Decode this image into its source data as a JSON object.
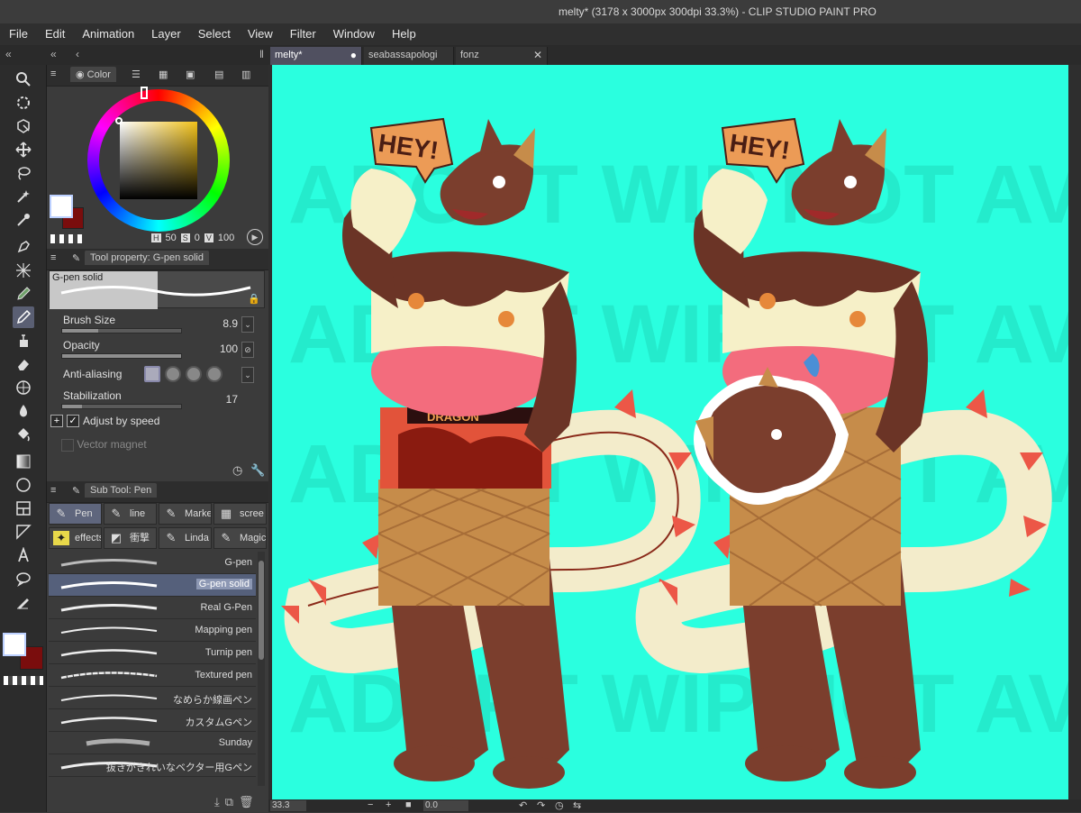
{
  "window": {
    "title": "melty* (3178 x 3000px 300dpi 33.3%)  - CLIP STUDIO PAINT PRO"
  },
  "menu": [
    "File",
    "Edit",
    "Animation",
    "Layer",
    "Select",
    "View",
    "Filter",
    "Window",
    "Help"
  ],
  "color_panel": {
    "tab_label": "Color",
    "main_color": "#ffffff",
    "sub_color": "#7a0d0d",
    "hue_color": "#f2c21a",
    "h_label": "H",
    "h_value": "50",
    "s_label": "S",
    "s_value": "0",
    "v_label": "V",
    "v_value": "100"
  },
  "tool_property": {
    "header": "Tool property: G-pen solid",
    "preset_name": "G-pen solid",
    "brush_size_label": "Brush Size",
    "brush_size_value": "8.9",
    "opacity_label": "Opacity",
    "opacity_value": "100",
    "opacity_fraction": 1.0,
    "anti_aliasing_label": "Anti-aliasing",
    "stabilization_label": "Stabilization",
    "stabilization_value": "17",
    "adjust_by_speed_label": "Adjust by speed",
    "adjust_by_speed_checked": true,
    "vector_magnet_label": "Vector magnet"
  },
  "sub_tool": {
    "header": "Sub Tool: Pen",
    "groups": [
      "Pen",
      "line",
      "Marke",
      "scree",
      "effects",
      "衝撃",
      "Linda",
      "Magic"
    ],
    "brushes": [
      "G-pen",
      "G-pen solid",
      "Real G-Pen",
      "Mapping pen",
      "Turnip pen",
      "Textured pen",
      "なめらか線画ペン",
      "カスタムGペン",
      "Sunday",
      "抜きがきれいなベクター用Gペン"
    ],
    "active_brush_index": 1
  },
  "documents": {
    "tabs": [
      "melty*",
      "seabassapologi",
      "fonz"
    ],
    "active_index": 0
  },
  "canvas": {
    "background_color": "#2affdf",
    "watermark_text": "ADOPT WIP NOT AVAILABLE YET",
    "speech_bubble_text": "HEY!",
    "shorts_text": "DRAGON"
  },
  "status": {
    "zoom": "33.3",
    "rotation": "0.0"
  }
}
